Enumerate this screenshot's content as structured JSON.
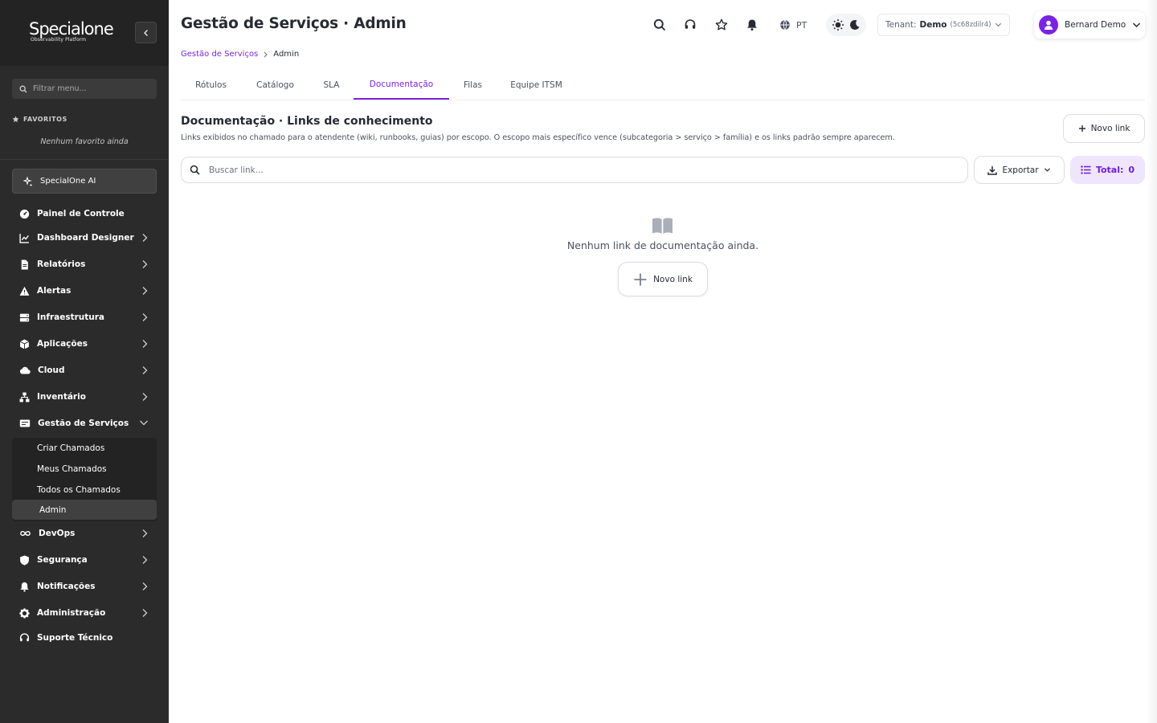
{
  "brand": {
    "name": "Specialone",
    "tagline": "Observability Platform"
  },
  "sidebar": {
    "filter_placeholder": "Filtrar menu...",
    "favorites_title": "FAVORITOS",
    "favorites_empty": "Nenhum favorito ainda",
    "ai_label": "SpecialOne AI",
    "items": [
      {
        "label": "Painel de Controle",
        "icon": "dashboard-gauge-icon"
      },
      {
        "label": "Dashboard Designer",
        "icon": "line-chart-icon"
      },
      {
        "label": "Relatórios",
        "icon": "report-file-icon"
      },
      {
        "label": "Alertas",
        "icon": "warning-icon"
      },
      {
        "label": "Infraestrutura",
        "icon": "server-icon"
      },
      {
        "label": "Aplicações",
        "icon": "cube-icon"
      },
      {
        "label": "Cloud",
        "icon": "cloud-icon"
      },
      {
        "label": "Inventário",
        "icon": "sitemap-icon"
      },
      {
        "label": "Gestão de Serviços",
        "icon": "service-desk-icon"
      },
      {
        "label": "DevOps",
        "icon": "infinity-icon"
      },
      {
        "label": "Segurança",
        "icon": "shield-icon"
      },
      {
        "label": "Notificações",
        "icon": "bell-icon"
      },
      {
        "label": "Administração",
        "icon": "gear-icon"
      },
      {
        "label": "Suporte Técnico",
        "icon": "headset-icon"
      }
    ],
    "sub_items": [
      "Criar Chamados",
      "Meus Chamados",
      "Todos os Chamados",
      "Admin"
    ]
  },
  "header": {
    "title": "Gestão de Serviços · Admin",
    "lang": "PT",
    "tenant_label": "Tenant:",
    "tenant_name": "Demo",
    "tenant_id": "(5c68zdilr4)",
    "user_name": "Bernard Demo"
  },
  "breadcrumb": {
    "parent": "Gestão de Serviços",
    "current": "Admin"
  },
  "tabs": [
    "Rótulos",
    "Catálogo",
    "SLA",
    "Documentação",
    "Filas",
    "Equipe ITSM"
  ],
  "active_tab": "Documentação",
  "section": {
    "title": "Documentação · Links de conhecimento",
    "description": "Links exibidos no chamado para o atendente (wiki, runbooks, guias) por escopo. O escopo mais específico vence (subcategoria > serviço > família) e os links padrão sempre aparecem.",
    "new_link": "Novo link"
  },
  "toolbar": {
    "search_placeholder": "Buscar link...",
    "export_label": "Exportar",
    "total_label": "Total:",
    "total_value": "0"
  },
  "empty_state": {
    "text": "Nenhum link de documentação ainda.",
    "button": "Novo link"
  },
  "colors": {
    "accent": "#7b23e2",
    "sidebar_bg": "#2b2b2b"
  }
}
